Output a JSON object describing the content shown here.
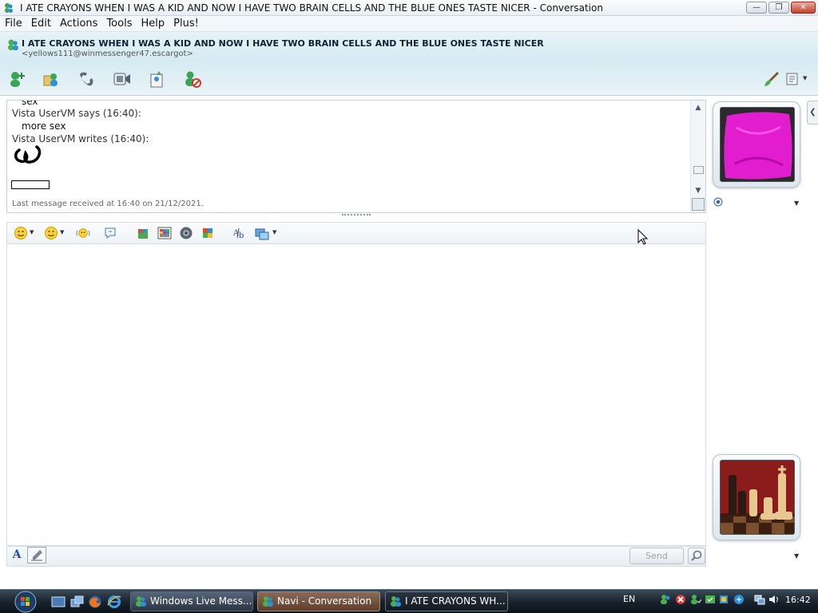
{
  "window": {
    "title": "I ATE CRAYONS WHEN I WAS A KID AND NOW I HAVE TWO BRAIN CELLS AND THE BLUE ONES TASTE NICER - Conversation",
    "controls": {
      "minimize": "—",
      "maximize": "❐",
      "close": "✕"
    }
  },
  "menu": [
    "File",
    "Edit",
    "Actions",
    "Tools",
    "Help",
    "Plus!"
  ],
  "contact": {
    "name": "I ATE CRAYONS WHEN I WAS A KID AND NOW I HAVE TWO BRAIN CELLS AND THE BLUE ONES TASTE NICER",
    "email": "<yellows111@winmessenger47.escargot>"
  },
  "toolbar": {
    "icons": [
      "invite-contact-icon",
      "share-files-icon",
      "call-icon",
      "video-call-icon",
      "activities-icon",
      "block-contact-icon"
    ],
    "right_icons": [
      "paintbrush-icon",
      "display-options-icon"
    ]
  },
  "history": {
    "partial_line": "sex",
    "entries": [
      {
        "header": "Vista UserVM says (16:40):",
        "text": "more sex"
      },
      {
        "header": "Vista UserVM writes (16:40):"
      }
    ],
    "status": "Last message received at 16:40 on 21/12/2021."
  },
  "format_toolbar": {
    "icons": [
      "emoticon-icon",
      "wink-icon",
      "nudge-icon",
      "voice-clip-icon",
      "gift-icon",
      "backgrounds-icon",
      "speaker-icon",
      "games-icon",
      "spellcheck-icon",
      "insert-image-icon"
    ]
  },
  "compose": {
    "font_label": "A",
    "send_label": "Send"
  },
  "taskbar": {
    "tasks": [
      {
        "label": "Windows Live Mess...",
        "state": "normal"
      },
      {
        "label": "Navi - Conversation",
        "state": "active"
      },
      {
        "label": "I ATE CRAYONS WH...",
        "state": "current"
      }
    ],
    "language": "EN",
    "clock": "16:42"
  },
  "colors": {
    "header_bg": "#d5eaf2",
    "taskbar": "#1a242e",
    "pillow": "#e21ccf",
    "accent": "#1e4fa0"
  }
}
